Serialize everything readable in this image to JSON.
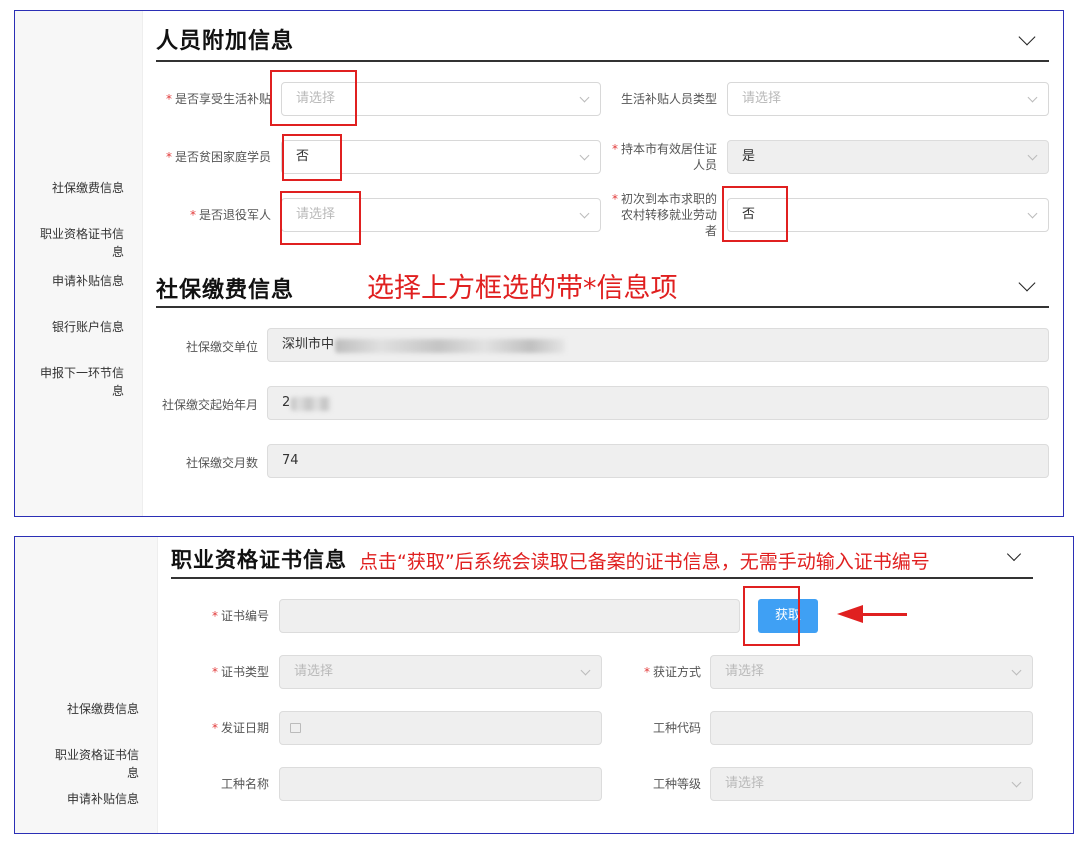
{
  "panel1": {
    "sidebar": [
      "社保缴费信息",
      "职业资格证书信\n息",
      "申请补贴信息",
      "银行账户信息",
      "申报下一环节信\n息"
    ],
    "section1_title": "人员附加信息",
    "section2_title": "社保缴费信息",
    "annotation": "选择上方框选的带*信息项",
    "fields": {
      "living_subsidy": {
        "label": "是否享受生活补贴",
        "placeholder": "请选择"
      },
      "subsidy_type": {
        "label": "生活补贴人员类型",
        "placeholder": "请选择"
      },
      "poor_family": {
        "label": "是否贫困家庭学员",
        "value": "否"
      },
      "residence_permit": {
        "label": "持本市有效居住证\n人员",
        "value": "是"
      },
      "veteran": {
        "label": "是否退役军人",
        "placeholder": "请选择"
      },
      "rural_worker": {
        "label": "初次到本市求职的\n农村转移就业劳动\n者",
        "value": "否"
      },
      "ss_unit": {
        "label": "社保缴交单位",
        "value": "深圳市中"
      },
      "ss_start": {
        "label": "社保缴交起始年月",
        "value": "2"
      },
      "ss_months": {
        "label": "社保缴交月数",
        "value": "74"
      }
    }
  },
  "panel2": {
    "sidebar": [
      "社保缴费信息",
      "职业资格证书信\n息",
      "申请补贴信息"
    ],
    "section_title": "职业资格证书信息",
    "annotation": "点击“获取”后系统会读取已备案的证书信息，无需手动输入证书编号",
    "fields": {
      "cert_no": {
        "label": "证书编号"
      },
      "get_button": "获取",
      "cert_type": {
        "label": "证书类型",
        "placeholder": "请选择"
      },
      "obtain_method": {
        "label": "获证方式",
        "placeholder": "请选择"
      },
      "issue_date": {
        "label": "发证日期"
      },
      "job_code": {
        "label": "工种代码"
      },
      "job_name": {
        "label": "工种名称"
      },
      "job_level": {
        "label": "工种等级",
        "placeholder": "请选择"
      }
    }
  },
  "colors": {
    "annotation_red": "#e02020",
    "border_blue": "#2b2fb5",
    "button_blue": "#3fa0f4"
  }
}
